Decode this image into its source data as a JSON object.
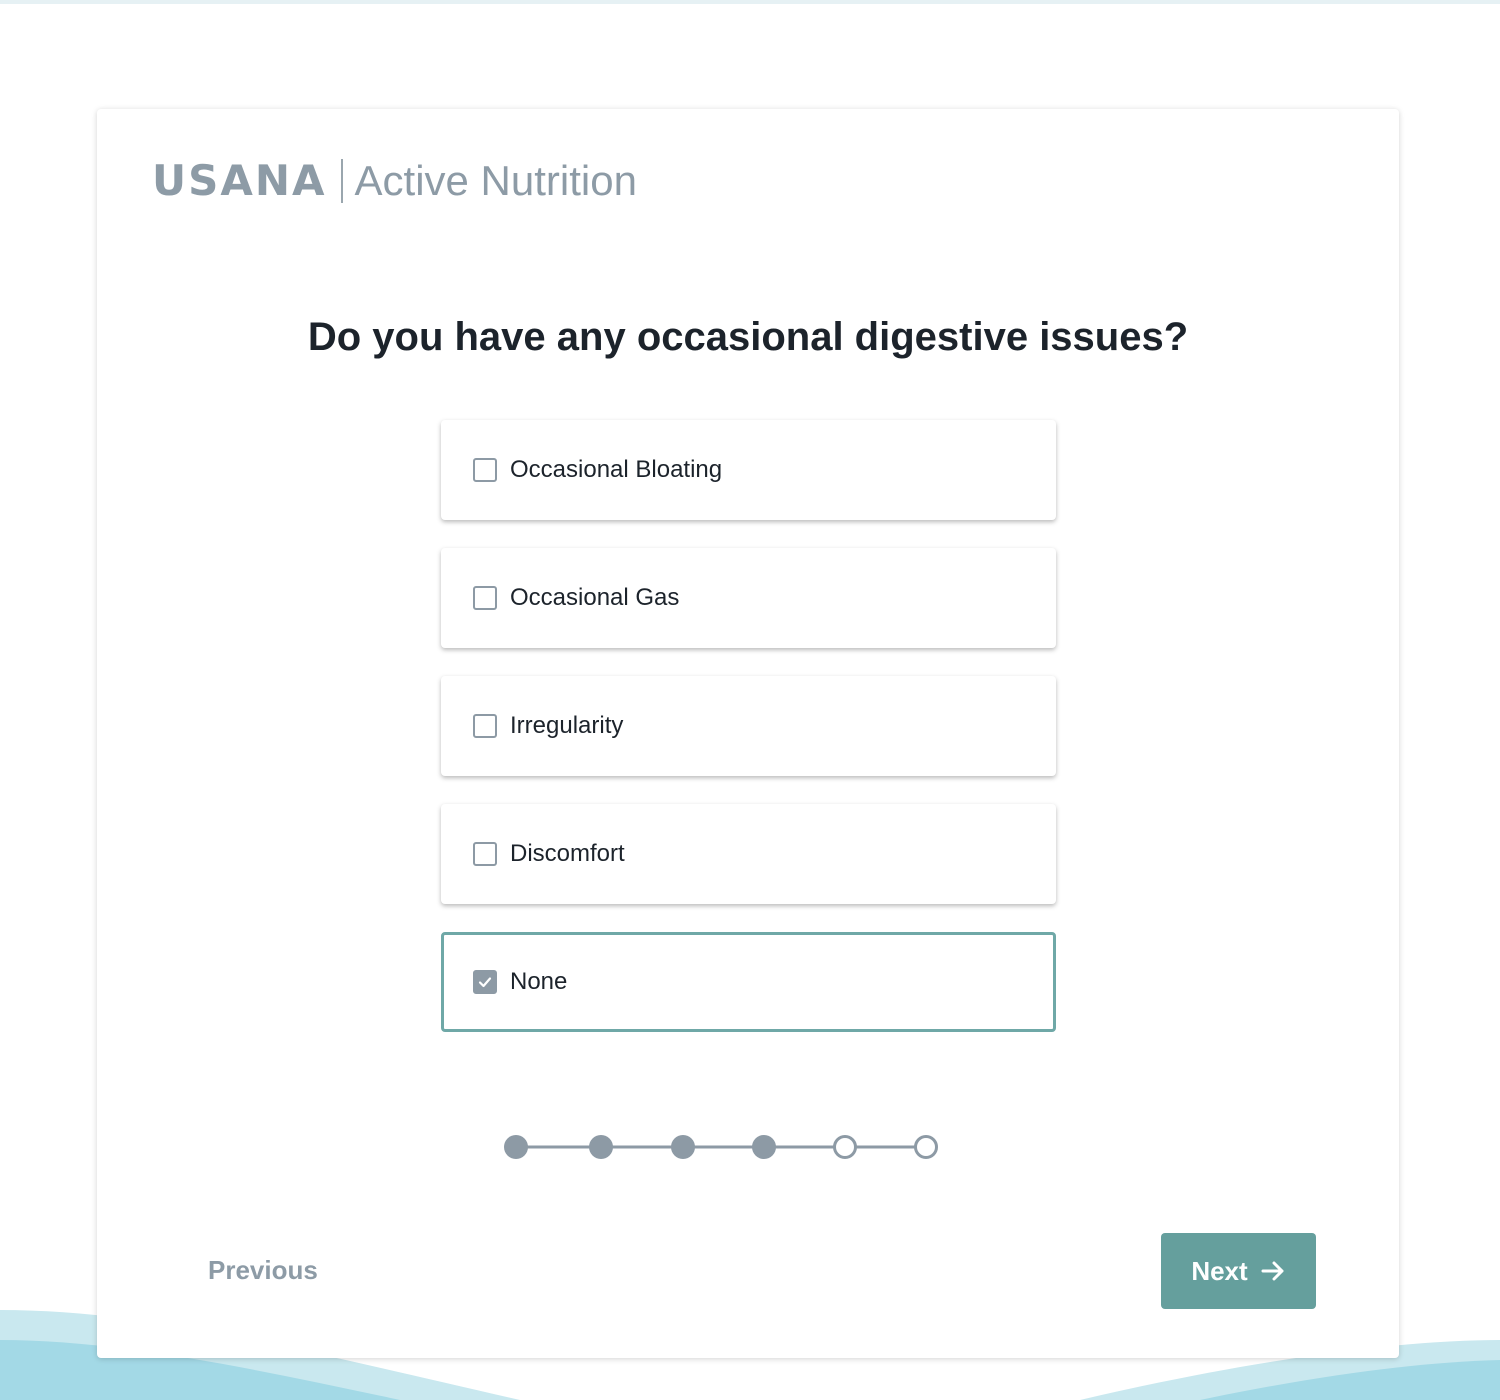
{
  "brand": {
    "logo_text": "USANA",
    "subtitle": "Active Nutrition"
  },
  "question": "Do you have any occasional digestive issues?",
  "options": [
    {
      "label": "Occasional Bloating",
      "checked": false
    },
    {
      "label": "Occasional Gas",
      "checked": false
    },
    {
      "label": "Irregularity",
      "checked": false
    },
    {
      "label": "Discomfort",
      "checked": false
    },
    {
      "label": "None",
      "checked": true
    }
  ],
  "progress": {
    "total_steps": 6,
    "completed_steps": 4
  },
  "navigation": {
    "previous_label": "Previous",
    "next_label": "Next"
  },
  "colors": {
    "accent": "#659f9d",
    "selected_border": "#6fa8a7",
    "muted": "#8d9ba6",
    "text": "#1c232b",
    "wave_light": "#c9e8ef",
    "wave_dark": "#a3d9e6"
  },
  "icons": {
    "checkbox": "checkbox-icon",
    "check": "check-icon",
    "next_arrow": "arrow-right-icon"
  }
}
